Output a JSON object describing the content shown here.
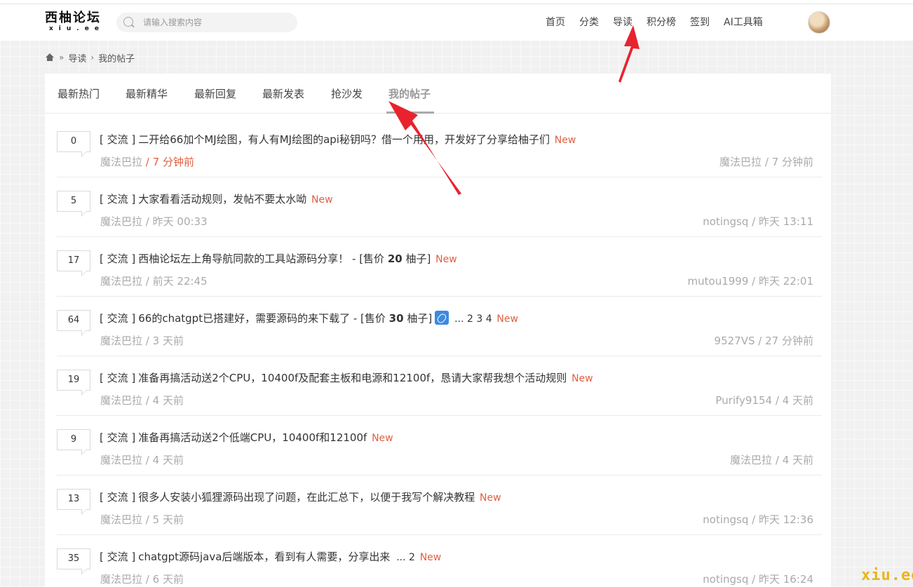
{
  "logo": {
    "main": "西柚论坛",
    "sub": "xiu.ee"
  },
  "search": {
    "placeholder": "请输入搜索内容"
  },
  "nav": {
    "items": [
      "首页",
      "分类",
      "导读",
      "积分榜",
      "签到",
      "AI工具箱"
    ]
  },
  "breadcrumb": {
    "items": [
      "导读",
      "我的帖子"
    ],
    "separator": "»",
    "separator2": "›"
  },
  "tabs": [
    "最新热门",
    "最新精华",
    "最新回复",
    "最新发表",
    "抢沙发",
    "我的帖子"
  ],
  "active_tab": "我的帖子",
  "labels": {
    "new": "New",
    "slash": "/"
  },
  "threads": [
    {
      "count": "0",
      "category": "[ 交流 ]",
      "title": "二开给66加个MJ绘图，有人有MJ绘图的api秘钥吗？借一个用用，开发好了分享给柚子们",
      "author": "魔法巴拉",
      "time": "7 分钟前",
      "time_recent": true,
      "last_user": "魔法巴拉",
      "last_time": "7 分钟前"
    },
    {
      "count": "5",
      "category": "[ 交流 ]",
      "title": "大家看看活动规则，发帖不要太水呦",
      "author": "魔法巴拉",
      "time": "昨天 00:33",
      "last_user": "notingsq",
      "last_time": "昨天 13:11"
    },
    {
      "count": "17",
      "category": "[ 交流 ]",
      "title": "西柚论坛左上角导航同款的工具站源码分享！ - ",
      "price_prefix": "[售价 ",
      "price": "20",
      "price_suffix": " 柚子]",
      "author": "魔法巴拉",
      "time": "前天 22:45",
      "last_user": "mutou1999",
      "last_time": "昨天 22:01"
    },
    {
      "count": "64",
      "category": "[ 交流 ]",
      "title": "66的chatgpt已搭建好，需要源码的来下载了 - ",
      "price_prefix": "[售价 ",
      "price": "30",
      "price_suffix": " 柚子]",
      "attachment_icon": "paperclip-icon",
      "pages": "... 2  3  4",
      "author": "魔法巴拉",
      "time": "3 天前",
      "last_user": "9527VS",
      "last_time": "27 分钟前"
    },
    {
      "count": "19",
      "category": "[ 交流 ]",
      "title": "准备再搞活动送2个CPU，10400f及配套主板和电源和12100f，恳请大家帮我想个活动规则",
      "author": "魔法巴拉",
      "time": "4 天前",
      "last_user": "Purify9154",
      "last_time": "4 天前"
    },
    {
      "count": "9",
      "category": "[ 交流 ]",
      "title": "准备再搞活动送2个低端CPU，10400f和12100f",
      "author": "魔法巴拉",
      "time": "4 天前",
      "last_user": "魔法巴拉",
      "last_time": "4 天前"
    },
    {
      "count": "13",
      "category": "[ 交流 ]",
      "title": "很多人安装小狐狸源码出现了问题，在此汇总下，以便于我写个解决教程",
      "author": "魔法巴拉",
      "time": "5 天前",
      "last_user": "notingsq",
      "last_time": "昨天 12:36"
    },
    {
      "count": "35",
      "category": "[ 交流 ]",
      "title": "chatgpt源码java后端版本，看到有人需要，分享出来 ",
      "pages": "... 2",
      "author": "魔法巴拉",
      "time": "6 天前",
      "last_user": "notingsq",
      "last_time": "昨天 16:24"
    }
  ],
  "watermark": "xiu.ee",
  "colors": {
    "new": "#e06040",
    "arrow": "#e8232e",
    "watermark": "#e8b520",
    "attachment": "#3b8be0"
  }
}
